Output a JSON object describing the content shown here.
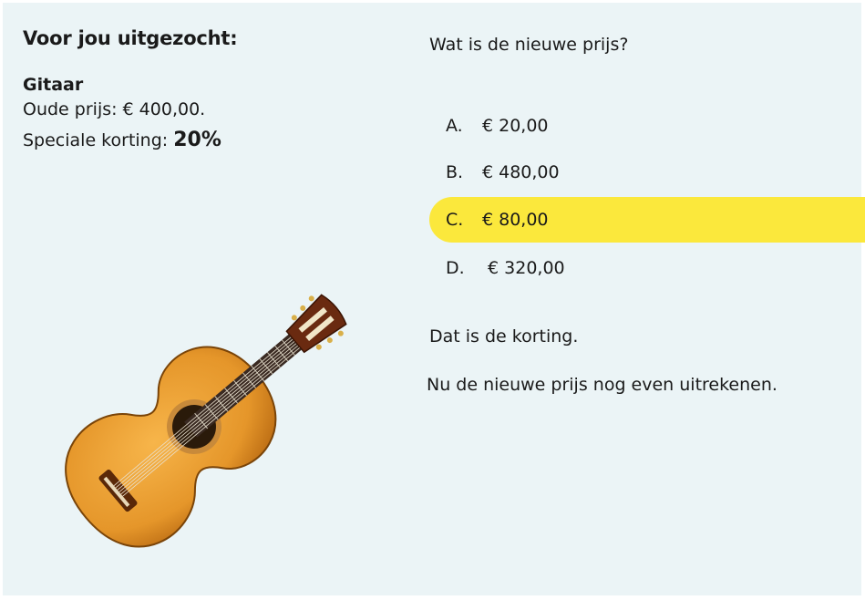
{
  "left": {
    "heading": "Voor jou uitgezocht:",
    "product_name": "Gitaar",
    "old_price_line": "Oude prijs: € 400,00.",
    "discount_label": "Speciale korting: ",
    "discount_value": "20%"
  },
  "question": "Wat is de nieuwe prijs?",
  "options": [
    {
      "letter": "A.",
      "value": "€ 20,00"
    },
    {
      "letter": "B.",
      "value": "€ 480,00"
    },
    {
      "letter": "C.",
      "value": "€ 80,00"
    },
    {
      "letter": "D.",
      "value": " € 320,00"
    }
  ],
  "selected_option": "C.",
  "feedback": {
    "line1": "Dat is de korting.",
    "line2": "Nu de nieuwe prijs nog even uitrekenen."
  },
  "colors": {
    "background": "#ebf4f6",
    "highlight": "#fbe83c",
    "guitar_body": "#e59a2a"
  },
  "image": {
    "icon": "guitar-image"
  }
}
